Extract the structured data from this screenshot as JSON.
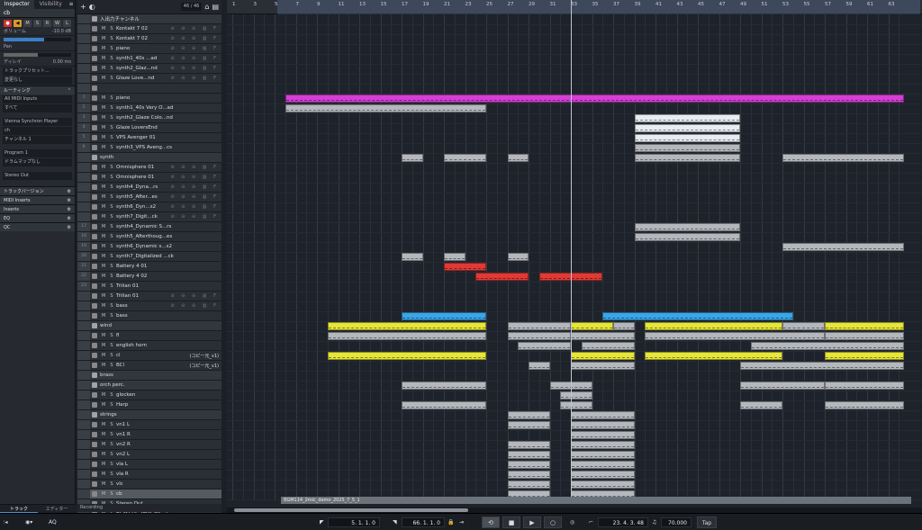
{
  "inspector": {
    "tabs": [
      "Inspector",
      "Visibility"
    ],
    "track_name": "cb",
    "msrw": [
      "M",
      "S",
      "R",
      "W",
      "L"
    ],
    "volume_label": "ボリューム",
    "volume_value": "-10.0 dB",
    "pan_label": "Pan",
    "delay_label": "ディレイ",
    "delay_value": "0.00 ms",
    "trackpreset_label": "トラックプリセット...",
    "nochange_label": "変更なし",
    "routing_label": "ルーティング",
    "midi_input": "All MIDI Inputs",
    "input_filter": "すべて",
    "output_instrument": "Vienna Synchron Player",
    "channel_value": "ch",
    "channel_label": "チャンネル 1",
    "program_label": "Program 1",
    "drum_label": "ドラムマップなし",
    "stereo_out": "Stereo Out",
    "sections": [
      "トラックバージョン",
      "MIDI Inserts",
      "Inserts",
      "EQ",
      "QC"
    ],
    "bottom_tabs": [
      "トラック",
      "エディター"
    ]
  },
  "tracklist": {
    "counter": "46 / 46",
    "ms": [
      "M",
      "S"
    ],
    "tracks": [
      {
        "num": "",
        "name": "入出力チャンネル",
        "type": "folder"
      },
      {
        "num": "",
        "name": "Kontakt 7 02",
        "type": "inst"
      },
      {
        "num": "",
        "name": "Kontakt 7 02",
        "type": "inst"
      },
      {
        "num": "",
        "name": "piano",
        "type": "inst"
      },
      {
        "num": "",
        "name": "synth1_40s ...ad",
        "type": "inst"
      },
      {
        "num": "",
        "name": "synth2_Glaz...nd",
        "type": "inst"
      },
      {
        "num": "",
        "name": "Glaze Love...nd",
        "type": "inst"
      },
      {
        "num": "",
        "name": "",
        "type": "blank"
      },
      {
        "num": "1",
        "name": "piano",
        "type": "midi"
      },
      {
        "num": "2",
        "name": "synth1_40s Very O...ad",
        "type": "midi"
      },
      {
        "num": "3",
        "name": "synth2_Glaze Colo...nd",
        "type": "midi"
      },
      {
        "num": "4",
        "name": "Glaze LoversEnd",
        "type": "midi"
      },
      {
        "num": "5",
        "name": "VPS Avenger 01",
        "type": "midi"
      },
      {
        "num": "6",
        "name": "synth3_VPS Aveng...cs",
        "type": "midi"
      },
      {
        "num": "",
        "name": "synth",
        "type": "folder"
      },
      {
        "num": "",
        "name": "Omnisphere 01",
        "type": "inst"
      },
      {
        "num": "",
        "name": "Omnisphere 01",
        "type": "inst"
      },
      {
        "num": "",
        "name": "synth4_Dyna...rs",
        "type": "inst"
      },
      {
        "num": "",
        "name": "synth5_After...es",
        "type": "inst"
      },
      {
        "num": "",
        "name": "synth6_Dyn...s2",
        "type": "inst"
      },
      {
        "num": "",
        "name": "synth7_Digit...ck",
        "type": "inst"
      },
      {
        "num": "17",
        "name": "synth4_Dynamic S...rs",
        "type": "midi"
      },
      {
        "num": "18",
        "name": "synth5_Afterthoug...es",
        "type": "midi"
      },
      {
        "num": "19",
        "name": "synth6_Dynamic s...s2",
        "type": "midi"
      },
      {
        "num": "20",
        "name": "synth7_Digitalized ...ck",
        "type": "midi"
      },
      {
        "num": "21",
        "name": "Battery 4 01",
        "type": "midi"
      },
      {
        "num": "22",
        "name": "Battery 4 02",
        "type": "midi"
      },
      {
        "num": "23",
        "name": "Trilian 01",
        "type": "midi"
      },
      {
        "num": "",
        "name": "Trilian 01",
        "type": "inst"
      },
      {
        "num": "",
        "name": "bass",
        "type": "inst"
      },
      {
        "num": "",
        "name": "bass",
        "type": "midi"
      },
      {
        "num": "",
        "name": "wind",
        "type": "folder"
      },
      {
        "num": "",
        "name": "fl",
        "type": "midi"
      },
      {
        "num": "",
        "name": "english horn",
        "type": "midi"
      },
      {
        "num": "",
        "name": "cl",
        "type": "midi",
        "extra": "(コピー元_v1)"
      },
      {
        "num": "",
        "name": "BCl",
        "type": "midi",
        "extra": "(コピー元_v1)"
      },
      {
        "num": "",
        "name": "brass",
        "type": "folder"
      },
      {
        "num": "",
        "name": "orch perc.",
        "type": "folder"
      },
      {
        "num": "",
        "name": "glocken",
        "type": "midi"
      },
      {
        "num": "",
        "name": "Harp",
        "type": "midi"
      },
      {
        "num": "",
        "name": "strings",
        "type": "folder"
      },
      {
        "num": "",
        "name": "vn1 L",
        "type": "midi"
      },
      {
        "num": "",
        "name": "vn1 R",
        "type": "midi"
      },
      {
        "num": "",
        "name": "vn2 R",
        "type": "midi"
      },
      {
        "num": "",
        "name": "vn2 L",
        "type": "midi"
      },
      {
        "num": "",
        "name": "vla L",
        "type": "midi"
      },
      {
        "num": "",
        "name": "vla R",
        "type": "midi"
      },
      {
        "num": "",
        "name": "vlc",
        "type": "midi"
      },
      {
        "num": "",
        "name": "cb",
        "type": "midi",
        "sel": true
      },
      {
        "num": "",
        "name": "Stereo Out",
        "type": "audio"
      },
      {
        "num": "",
        "name": "BGM114_2mic_de...1",
        "type": "audio"
      }
    ],
    "recording_label": "Recording"
  },
  "ruler": {
    "marks": [
      "1",
      "3",
      "5",
      "7",
      "9",
      "11",
      "13",
      "15",
      "17",
      "19",
      "21",
      "23",
      "25",
      "27",
      "29",
      "31",
      "33",
      "35",
      "37",
      "39",
      "41",
      "43",
      "45",
      "47",
      "49",
      "51",
      "53",
      "55",
      "57",
      "59",
      "61",
      "63"
    ]
  },
  "audio_event_label": "BGM114_2mic_demo_2025_7_5_1",
  "colors": {
    "magenta": "#d43fd6",
    "gray": "#b4b8bd",
    "red": "#e03a36",
    "blue": "#3aa6e8",
    "yellow": "#e6e63a",
    "white": "#e8ecf0"
  },
  "transport": {
    "left_locator": "5. 1. 1.  0",
    "right_locator": "66. 1. 1.  0",
    "position": "23. 4. 3. 48",
    "tempo": "70.000",
    "tap_label": "Tap",
    "aq_label": "AQ"
  }
}
